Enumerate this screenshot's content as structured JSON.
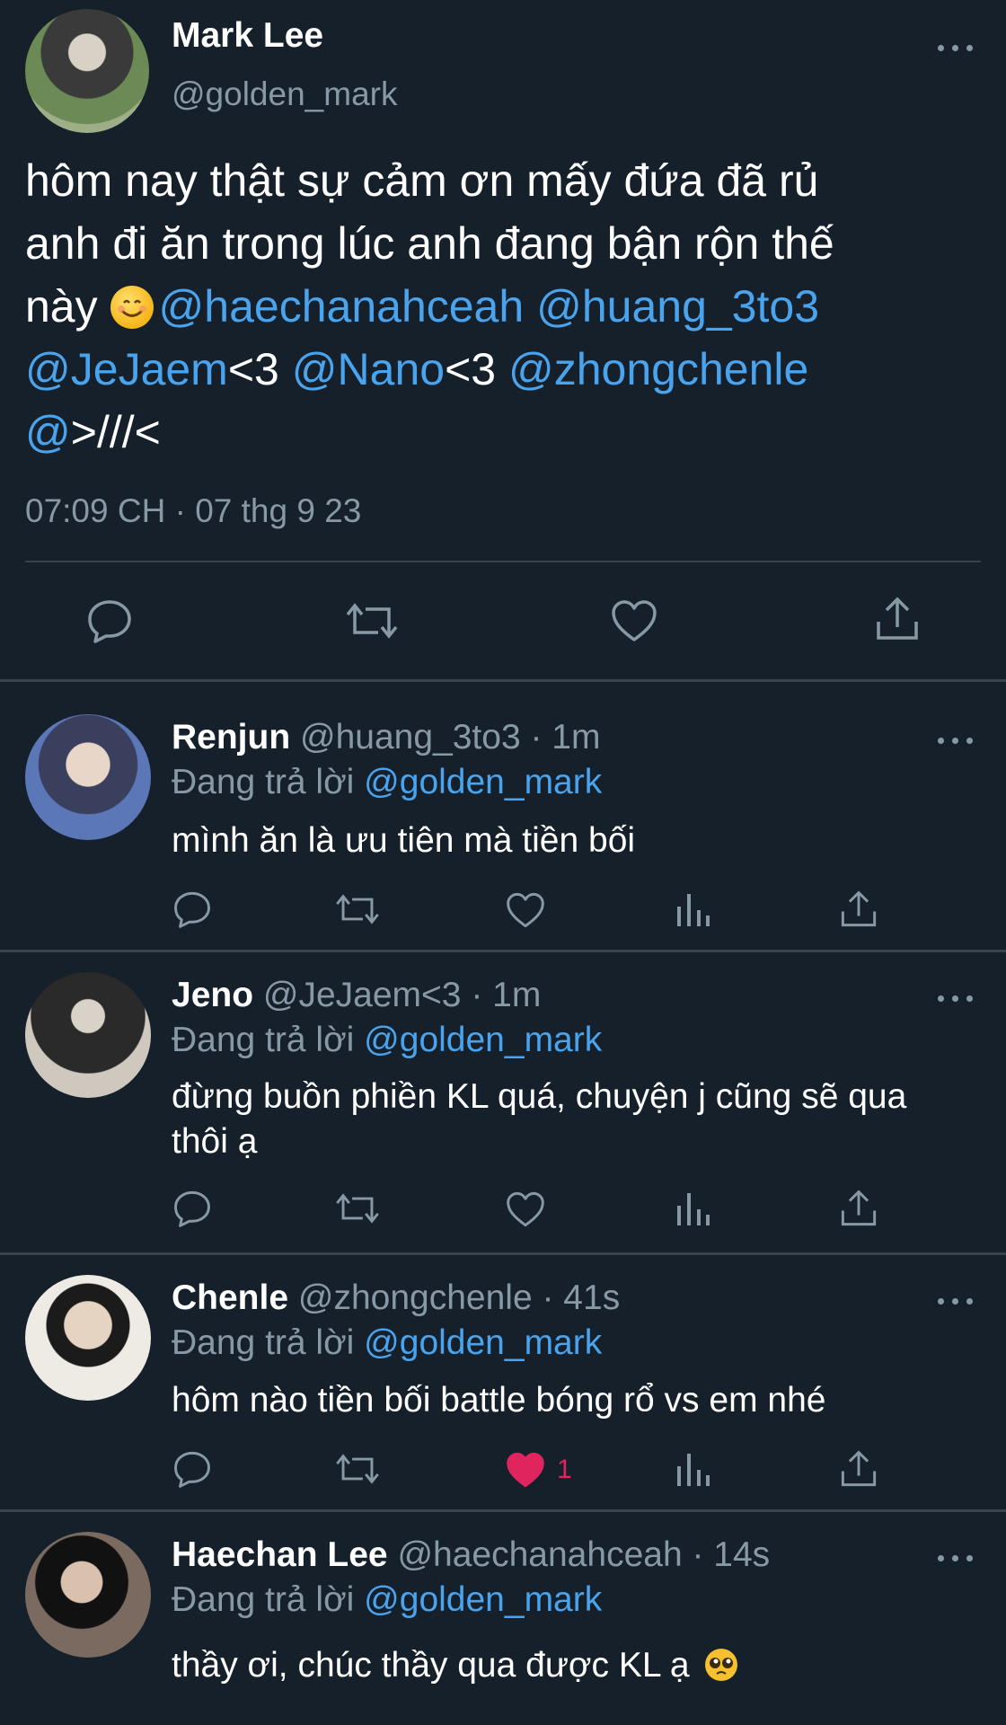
{
  "main_tweet": {
    "name": "Mark Lee",
    "handle": "@golden_mark",
    "text_line1": "hôm nay thật sự cảm ơn mấy đứa đã rủ",
    "text_line2": "anh đi ăn trong lúc anh đang bận rộn thế",
    "text_line3_prefix": "này",
    "mention_1": "@haechanahceah",
    "mention_2": "@huang_3to3",
    "mention_3": "@JeJaem",
    "heart_text_1": "<3",
    "mention_4": "@Nano",
    "heart_text_2": "<3",
    "mention_5": "@zhongchenle",
    "mention_6": "@",
    "tail_text": ">///<",
    "timestamp": "07:09 CH · 07 thg 9 23",
    "emoji": "smiling-face"
  },
  "replies": [
    {
      "name": "Renjun",
      "handle_time": "@huang_3to3 · 1m",
      "replying_label": "Đang trả lời",
      "replying_to": "@golden_mark",
      "text": "mình ăn là ưu tiên mà tiền bối",
      "like_count": ""
    },
    {
      "name": "Jeno",
      "handle_time": "@JeJaem<3 · 1m",
      "replying_label": "Đang trả lời",
      "replying_to": "@golden_mark",
      "text": "đừng buồn phiền KL quá, chuyện j cũng sẽ qua thôi ạ",
      "like_count": ""
    },
    {
      "name": "Chenle",
      "handle_time": "@zhongchenle · 41s",
      "replying_label": "Đang trả lời",
      "replying_to": "@golden_mark",
      "text": "hôm nào tiền bối battle bóng rổ vs em nhé",
      "like_count": "1",
      "liked": true
    },
    {
      "name": "Haechan Lee",
      "handle_time": "@haechanahceah · 14s",
      "replying_label": "Đang trả lời",
      "replying_to": "@golden_mark",
      "text": "thầy ơi, chúc thầy qua được KL ạ",
      "emoji": "pleading-face"
    }
  ],
  "colors": {
    "background": "#15202b",
    "mention": "#4aa3ed",
    "secondary_text": "#8899a6",
    "like": "#e0245e",
    "divider": "#38444d"
  }
}
